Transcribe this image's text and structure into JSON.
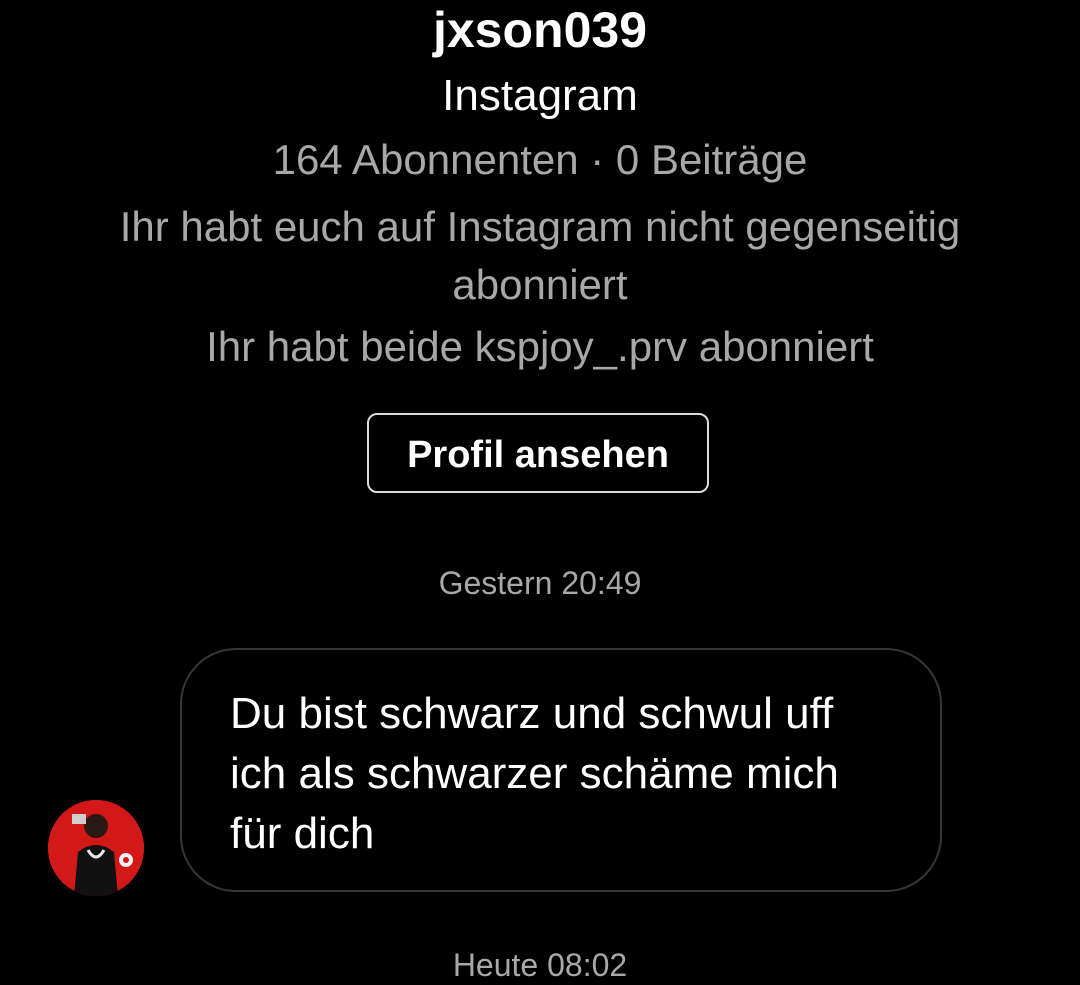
{
  "profile": {
    "username": "jxson039",
    "platform": "Instagram",
    "stats": "164 Abonnenten · 0 Beiträge",
    "mutual_status": "Ihr habt euch auf Instagram nicht gegenseitig abonniert",
    "common_follow": "Ihr habt beide kspjoy_.prv abonniert",
    "view_profile_label": "Profil ansehen"
  },
  "messages": [
    {
      "timestamp": "Gestern 20:49",
      "text": "Du bist schwarz und schwul uff ich als schwarzer schäme mich für dich",
      "sender": "jxson039"
    }
  ],
  "next_timestamp": "Heute 08:02",
  "colors": {
    "background": "#000000",
    "primary_text": "#ffffff",
    "secondary_text": "#a8a8a8",
    "bubble_border": "#363636",
    "button_border": "#dbdbdb",
    "avatar_background": "#d31818"
  }
}
